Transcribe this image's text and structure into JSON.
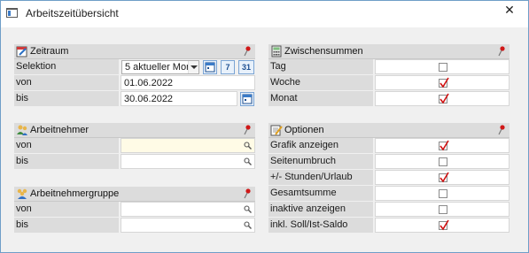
{
  "window": {
    "title": "Arbeitszeitübersicht",
    "close_glyph": "✕"
  },
  "zeitraum": {
    "title": "Zeitraum",
    "rows": {
      "selektion_label": "Selektion",
      "selektion_value": "5  aktueller Mon",
      "von_label": "von",
      "von_value": "01.06.2022",
      "bis_label": "bis",
      "bis_value": "30.06.2022"
    },
    "buttons": {
      "week_label": "7",
      "month_label": "31"
    }
  },
  "arbeitnehmer": {
    "title": "Arbeitnehmer",
    "von_label": "von",
    "von_value": "",
    "bis_label": "bis",
    "bis_value": ""
  },
  "arbeitnehmergruppe": {
    "title": "Arbeitnehmergruppe",
    "von_label": "von",
    "von_value": "",
    "bis_label": "bis",
    "bis_value": ""
  },
  "zwischensummen": {
    "title": "Zwischensummen",
    "items": [
      {
        "label": "Tag",
        "checked": false
      },
      {
        "label": "Woche",
        "checked": true
      },
      {
        "label": "Monat",
        "checked": true
      }
    ]
  },
  "optionen": {
    "title": "Optionen",
    "items": [
      {
        "label": "Grafik anzeigen",
        "checked": true
      },
      {
        "label": "Seitenumbruch",
        "checked": false
      },
      {
        "label": "+/- Stunden/Urlaub",
        "checked": true
      },
      {
        "label": "Gesamtsumme",
        "checked": false
      },
      {
        "label": "inaktive anzeigen",
        "checked": false
      },
      {
        "label": "inkl. Soll/Ist-Saldo",
        "checked": true
      }
    ]
  },
  "colors": {
    "check_mark": "#d01010",
    "pin_head": "#d01818",
    "panel_header": "#dcdcdc"
  }
}
